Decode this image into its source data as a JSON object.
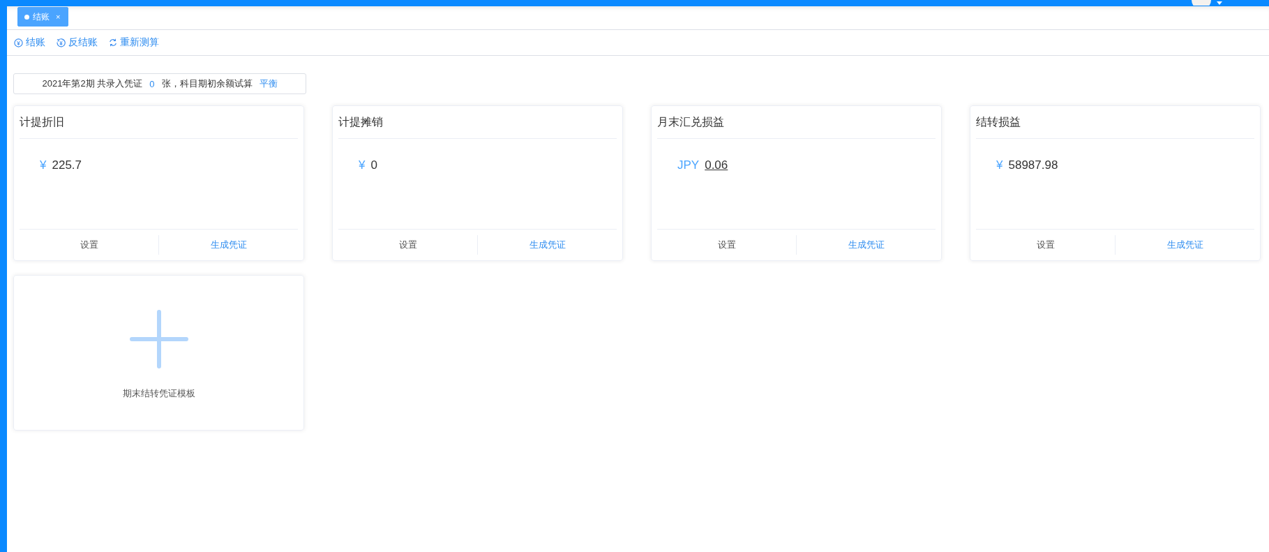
{
  "tabs": [
    {
      "label": "结账",
      "selected": true,
      "close": "×"
    }
  ],
  "toolbar": [
    {
      "kind": "close",
      "label": "结账"
    },
    {
      "kind": "reopen",
      "label": "反结账"
    },
    {
      "kind": "refresh",
      "label": "重新测算"
    }
  ],
  "summary": {
    "text_before": "2021年第2期 共录入凭证",
    "count": "0",
    "text_after": "张，科目期初余额试算",
    "status": "平衡"
  },
  "cards": [
    {
      "title": "计提折旧",
      "currency": "¥",
      "amount": "225.7",
      "underlined": false,
      "actions": [
        "设置",
        "生成凭证"
      ]
    },
    {
      "title": "计提摊销",
      "currency": "¥",
      "amount": "0",
      "underlined": false,
      "actions": [
        "设置",
        "生成凭证"
      ]
    },
    {
      "title": "月末汇兑损益",
      "currency": "JPY",
      "amount": "0.06",
      "underlined": true,
      "actions": [
        "设置",
        "生成凭证"
      ]
    },
    {
      "title": "结转损益",
      "currency": "¥",
      "amount": "58987.98",
      "underlined": false,
      "actions": [
        "设置",
        "生成凭证"
      ]
    }
  ],
  "template_card": {
    "label": "期末结转凭证模板"
  }
}
